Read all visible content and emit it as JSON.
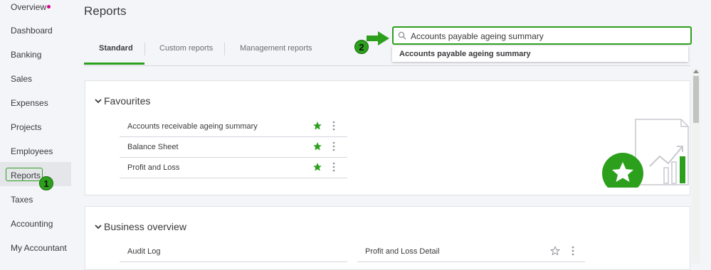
{
  "sidebar": {
    "items": [
      {
        "label": "Overview"
      },
      {
        "label": "Dashboard"
      },
      {
        "label": "Banking"
      },
      {
        "label": "Sales"
      },
      {
        "label": "Expenses"
      },
      {
        "label": "Projects"
      },
      {
        "label": "Employees"
      },
      {
        "label": "Reports"
      },
      {
        "label": "Taxes"
      },
      {
        "label": "Accounting"
      },
      {
        "label": "My Accountant"
      }
    ]
  },
  "callouts": {
    "step1": "1",
    "step2": "2"
  },
  "header": {
    "title": "Reports"
  },
  "tabs": [
    {
      "label": "Standard"
    },
    {
      "label": "Custom reports"
    },
    {
      "label": "Management reports"
    }
  ],
  "search": {
    "value": "Accounts payable ageing summary",
    "suggestion": "Accounts payable ageing summary"
  },
  "favourites": {
    "title": "Favourites",
    "items": [
      {
        "label": "Accounts receivable ageing summary",
        "starred": true
      },
      {
        "label": "Balance Sheet",
        "starred": true
      },
      {
        "label": "Profit and Loss",
        "starred": true
      }
    ]
  },
  "business_overview": {
    "title": "Business overview",
    "items": [
      {
        "label": "Audit Log"
      },
      {
        "label": "Profit and Loss Detail",
        "starred": false
      }
    ]
  },
  "colors": {
    "accent": "#2ca01c",
    "overview_dot": "#e0008a"
  }
}
